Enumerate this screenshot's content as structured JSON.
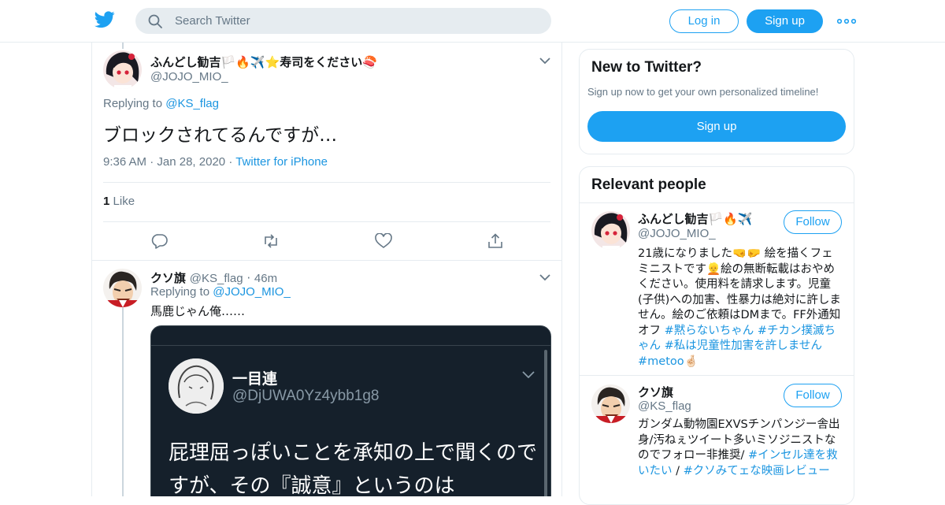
{
  "topbar": {
    "logo_icon": "twitter-bird-icon",
    "search_placeholder": "Search Twitter",
    "login_label": "Log in",
    "signup_label": "Sign up",
    "more_icon": "more-dots-icon",
    "brand_color": "#1da1f2"
  },
  "tweet_main": {
    "display_name": "ふんどし勧吉🏳️🔥✈️⭐寿司をください🍣",
    "handle": "@JOJO_MIO_",
    "replying_prefix": "Replying to",
    "replying_to": "@KS_flag",
    "text": "ブロックされてるんですが…",
    "time": "9:36 AM",
    "dot1": "·",
    "date": "Jan 28, 2020",
    "dot2": "·",
    "source": "Twitter for iPhone",
    "like_count": "1",
    "like_label": "Like",
    "actions": [
      "reply-icon",
      "retweet-icon",
      "like-icon",
      "share-icon"
    ]
  },
  "tweet_reply": {
    "display_name": "クソ旗",
    "handle": "@KS_flag",
    "dot": "·",
    "time_ago": "46m",
    "replying_prefix": "Replying to",
    "replying_to": "@JOJO_MIO_",
    "text": "馬鹿じゃん俺……",
    "media": {
      "name": "一目連",
      "handle": "@DjUWA0Yz4ybb1g8",
      "text": "屁理屈っぽいことを承知の上で聞くのですが、その『誠意』というのは"
    }
  },
  "sidebar": {
    "new_card": {
      "title": "New to Twitter?",
      "subtitle": "Sign up now to get your own personalized timeline!",
      "button": "Sign up"
    },
    "relevant": {
      "title": "Relevant people",
      "people": [
        {
          "name": "ふんどし勧吉🏳️🔥✈️",
          "handle": "@JOJO_MIO_",
          "follow": "Follow",
          "bio_plain": "21歳になりました🤜🤛 絵を描くフェミニストです👱絵の無断転載はおやめください。使用料を請求します。児童(子供)への加害、性暴力は絶対に許しません。絵のご依頼はDMまで。FF外通知オフ ",
          "tag1": "#黙らないちゃん",
          "tag2": "#チカン撲滅ちゃん",
          "tag3": "#私は児童性加害を許しません",
          "tag4": "#metoo",
          "bio_tail": "🤞🏻"
        },
        {
          "name": "クソ旗",
          "handle": "@KS_flag",
          "follow": "Follow",
          "bio_plain": "ガンダム動物園EXVSチンパンジー舎出身/汚ねぇツイート多いミソジニストなのでフォロー非推奨/ ",
          "tag1": "#インセル達を救いたい",
          "sep": " / ",
          "tag2": "#クソみてェな映画レビュー"
        }
      ]
    }
  }
}
